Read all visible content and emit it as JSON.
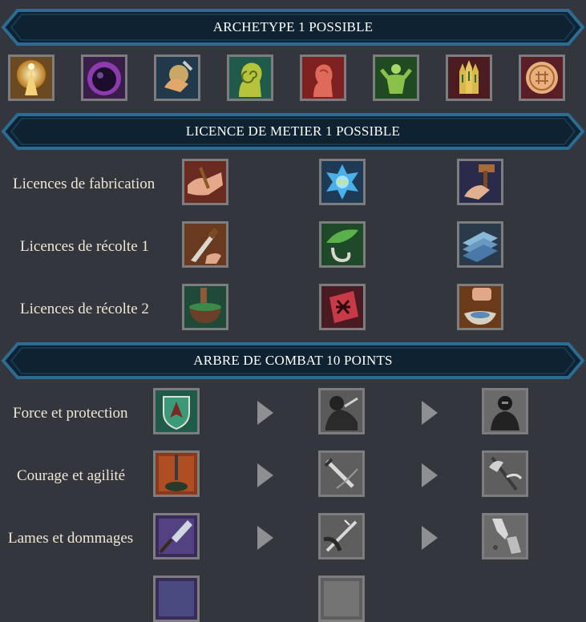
{
  "sections": {
    "archetype_title": "ARCHETYPE 1 POSSIBLE",
    "licence_title": "LICENCE DE METIER 1 POSSIBLE",
    "combat_title": "ARBRE DE COMBAT 10 POINTS"
  },
  "archetypes": [
    {
      "icon": "light-figure-icon"
    },
    {
      "icon": "purple-orb-icon"
    },
    {
      "icon": "glowing-hand-icon"
    },
    {
      "icon": "spiral-mind-icon"
    },
    {
      "icon": "red-head-icon"
    },
    {
      "icon": "flexing-figure-icon"
    },
    {
      "icon": "spire-towers-icon"
    },
    {
      "icon": "round-seal-icon"
    }
  ],
  "licences": [
    {
      "label": "Licences de fabrication",
      "icons": [
        "handshake-icon",
        "blue-emblem-icon",
        "hammer-hand-icon"
      ]
    },
    {
      "label": "Licences de récolte 1",
      "icons": [
        "knife-icon",
        "sickle-herb-icon",
        "blue-plates-icon"
      ]
    },
    {
      "label": "Licences de récolte 2",
      "icons": [
        "mortar-pestle-icon",
        "red-rune-icon",
        "fist-bowl-icon"
      ]
    }
  ],
  "combat": [
    {
      "label": "Force et protection",
      "icons": [
        "green-shield-icon",
        "armored-warrior-icon",
        "dark-knight-icon"
      ]
    },
    {
      "label": "Courage et agilité",
      "icons": [
        "sword-fire-icon",
        "sword-slash-icon",
        "axe-strike-icon"
      ]
    },
    {
      "label": "Lames et dommages",
      "icons": [
        "spear-tip-icon",
        "blade-slash-icon",
        "broken-blade-icon"
      ]
    }
  ],
  "colors": {
    "background": "#33363d",
    "banner_fill": "#0e2232",
    "banner_edge": "#2c6c93",
    "icon_border": "#7d7d80"
  }
}
